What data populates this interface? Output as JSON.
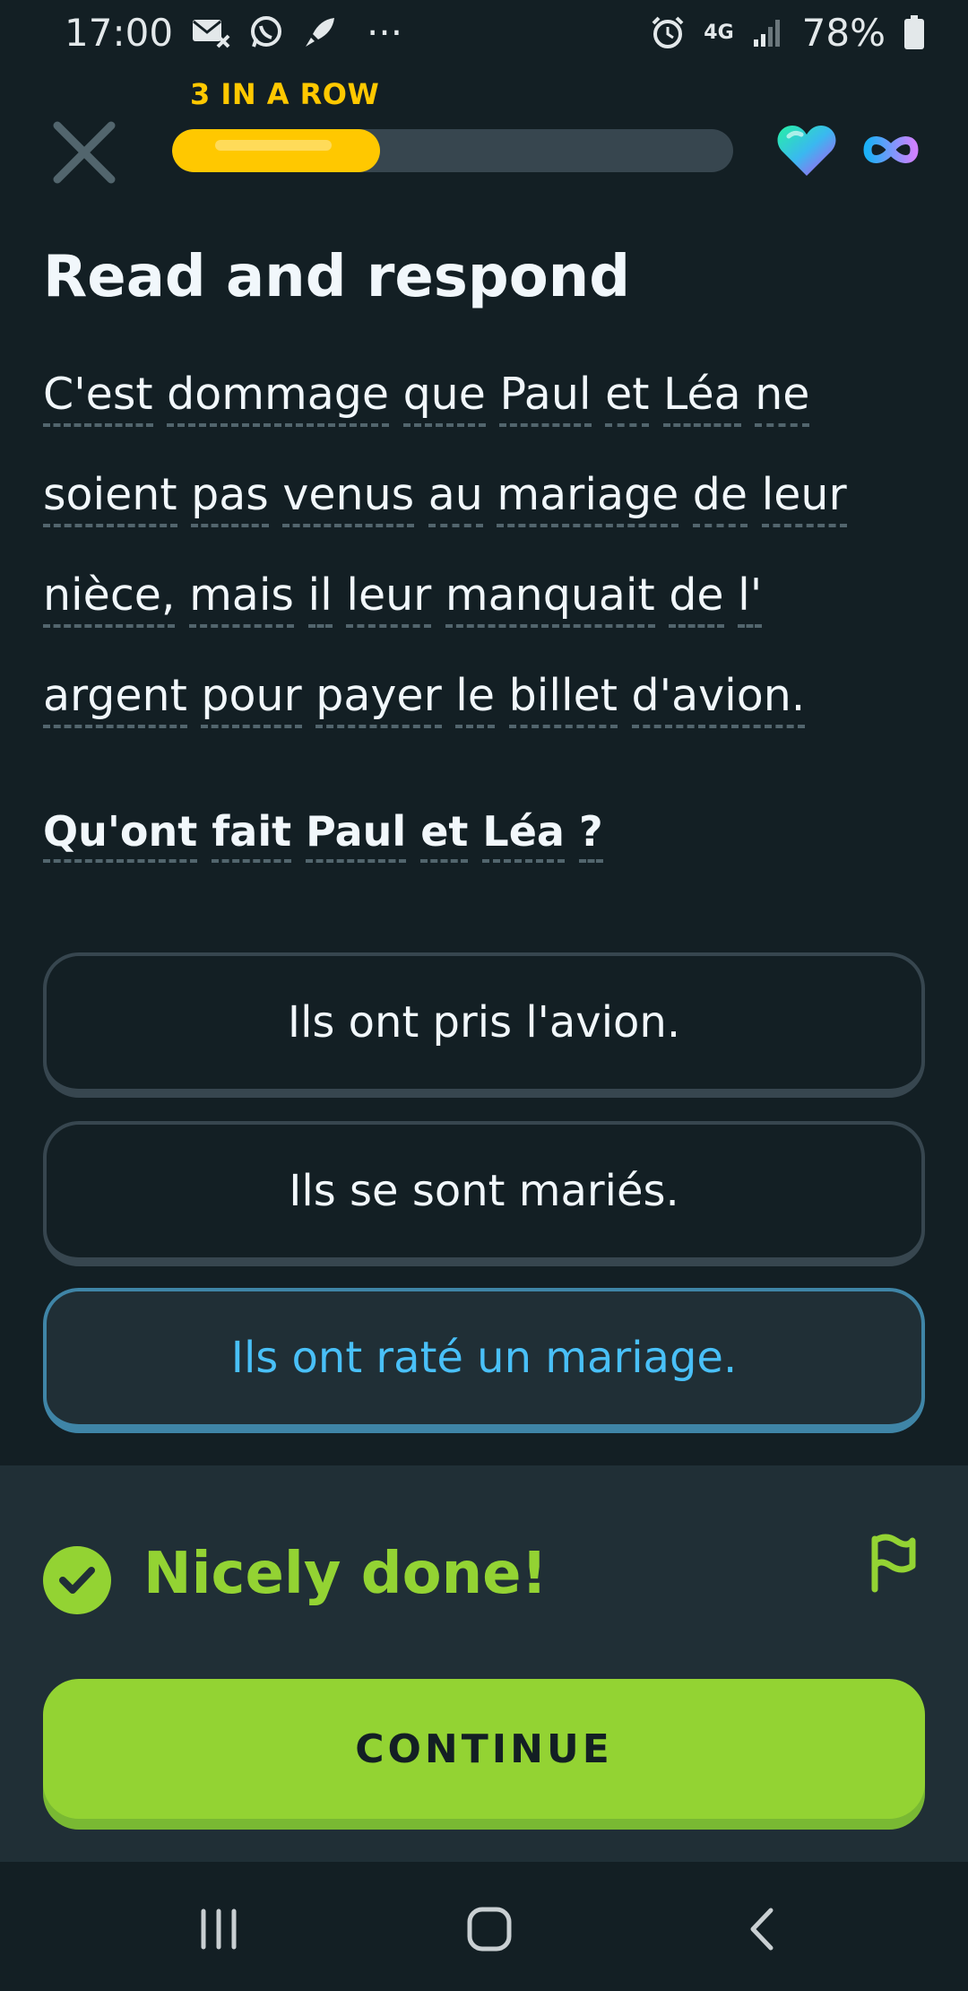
{
  "status_bar": {
    "time": "17:00",
    "more": "···",
    "network": "4G",
    "battery": "78%"
  },
  "header": {
    "streak_label": "3 IN A ROW",
    "progress_percent": 37,
    "hearts": "∞",
    "icons": [
      "close-icon",
      "heart-icon",
      "infinity-icon"
    ]
  },
  "exercise": {
    "title": "Read and respond",
    "passage_lines": [
      [
        "C'est",
        "dommage",
        "que",
        "Paul",
        "et",
        "Léa",
        "ne"
      ],
      [
        "soient",
        "pas",
        "venus",
        "au",
        "mariage",
        "de",
        "leur"
      ],
      [
        "nièce,",
        "mais",
        "il",
        "leur",
        "manquait",
        "de",
        "l'"
      ],
      [
        "argent",
        "pour",
        "payer",
        "le",
        "billet",
        "d'avion."
      ]
    ],
    "question_words": [
      "Qu'ont",
      "fait",
      "Paul",
      "et",
      "Léa",
      "?"
    ],
    "options": [
      {
        "label": "Ils ont pris l'avion.",
        "selected": false
      },
      {
        "label": "Ils se sont mariés.",
        "selected": false
      },
      {
        "label": "Ils ont raté un mariage.",
        "selected": true
      }
    ]
  },
  "feedback": {
    "message": "Nicely done!",
    "continue_label": "CONTINUE"
  },
  "colors": {
    "background": "#131f24",
    "accent_green": "#93d333",
    "accent_blue": "#49c0f8",
    "streak_yellow": "#ffc800"
  }
}
